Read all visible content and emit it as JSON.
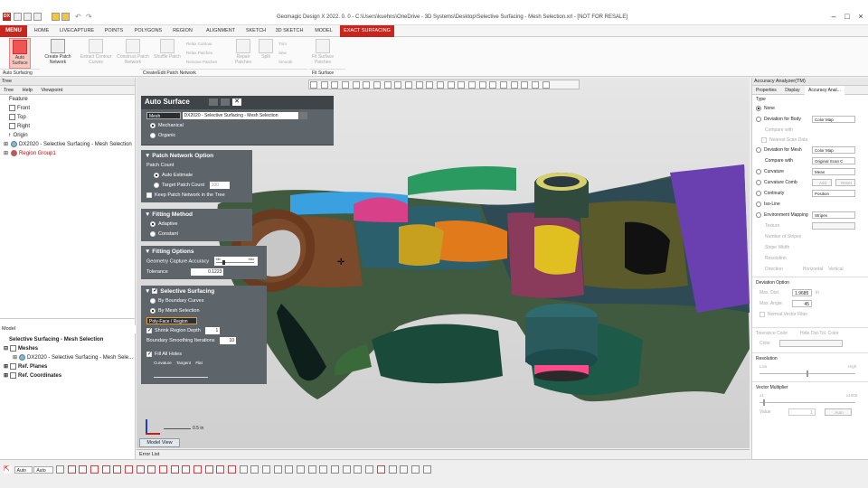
{
  "app_title": "Geomagic Design X 2022. 0. 0 - C:\\Users\\kuehns\\OneDrive - 3D Systems\\Desktop\\Selective Surfacing - Mesh Selection.xrl - [NOT FOR RESALE]",
  "app_icon_text": "DX",
  "ribbon_tabs": [
    "MENU",
    "HOME",
    "LIVECAPTURE",
    "POINTS",
    "POLYGONS",
    "REGION",
    "ALIGNMENT",
    "SKETCH",
    "3D SKETCH",
    "MODEL",
    "EXACT SURFACING"
  ],
  "ribbon": {
    "auto_surface": "Auto Surface",
    "create_patch_network": "Create Patch Network",
    "extract_contour_curves": "Extract Contour Curves",
    "construct_patch_network": "Construct Patch Network",
    "shuffle_patch": "Shuffle Patch",
    "relax_contour": "Relax Contour",
    "relax_patches": "Relax Patches",
    "remove_patches": "Remove Patches",
    "repair_patches": "Repair Patches",
    "split": "Split",
    "trim": "Trim",
    "sew": "Sew",
    "smooth": "Smooth",
    "fit_surface": "Fit Surface Patches",
    "group_auto": "Auto Surfacing",
    "group_create": "Create/Edit Patch Network",
    "group_fit": "Fit Surface"
  },
  "left_panel": {
    "title": "Tree",
    "tabs": [
      "Tree",
      "Help",
      "Viewpoint"
    ],
    "feature_label": "Feature",
    "tree_items": [
      "Front",
      "Top",
      "Right",
      "Origin",
      "DX2020 - Selective Surfacing - Mesh Selection",
      "Region Group1"
    ],
    "model_title": "Model",
    "model_root": "Selective Surfacing - Mesh Selection",
    "model_items": [
      "Meshes",
      "DX2020 - Selective Surfacing - Mesh Sele...",
      "Ref. Planes",
      "Ref. Coordinates"
    ]
  },
  "auto_surface": {
    "title": "Auto Surface",
    "mesh_button": "Mesh",
    "mesh_value": "DX2020 - Selective Surfacing - Mesh Selection",
    "mechanical": "Mechanical",
    "organic": "Organic",
    "patch_network_title": "Patch Network Option",
    "patch_count": "Patch Count",
    "auto_estimate": "Auto Estimate",
    "target_patch_count": "Target Patch Count",
    "target_patch_value": "100",
    "keep_patch": "Keep Patch Network in the Tree",
    "fitting_method_title": "Fitting Method",
    "adaptive": "Adaptive",
    "constant": "Constant",
    "fitting_options_title": "Fitting Options",
    "geometry_capture": "Geometry Capture Accuracy",
    "slider_min": "Min",
    "slider_max": "Max",
    "tolerance_label": "Tolerance",
    "tolerance_value": "0.1223",
    "selective_title": "Selective Surfacing",
    "by_boundary": "By Boundary Curves",
    "by_mesh": "By Mesh Selection",
    "polyface_button": "Poly-Face / Region",
    "shrink_region": "Shrink Region Depth",
    "shrink_value": "1",
    "boundary_smoothing": "Boundary Smoothing Iterations",
    "boundary_value": "10",
    "fill_all_holes": "Fill All Holes",
    "fill_labels": [
      "Curvature",
      "Tangent",
      "Flat"
    ]
  },
  "viewport": {
    "tab_label": "Model View",
    "scale_label": "0.5 in"
  },
  "right_panel": {
    "title": "Accuracy Analyzer(TM)",
    "tabs": [
      "Properties",
      "Display",
      "Accuracy Anal..."
    ],
    "type_label": "Type",
    "none": "None",
    "dev_body": "Deviation for Body",
    "dev_body_dd": "Color Map",
    "compare_with": "Compare with",
    "nearest_scan": "Nearest Scan Data",
    "dev_mesh": "Deviation for Mesh",
    "dev_mesh_dd": "Color Map",
    "compare_with2": "Compare with",
    "compare_with2_dd": "Original Scan C",
    "curvature": "Curvature",
    "curvature_dd": "Mean",
    "curvature_comb": "Curvature Comb",
    "comb_add": "Add",
    "comb_reset": "Reset",
    "continuity": "Continuity",
    "continuity_dd": "Position",
    "iso_line": "Iso-Line",
    "env_mapping": "Environment Mapping",
    "env_dd": "Stripes",
    "texture": "Texture",
    "num_stripes": "Number of Stripes",
    "stripe_width": "Stripe Width",
    "resolution": "Resolution",
    "direction": "Direction",
    "horizontal": "Horizontal",
    "vertical": "Vertical",
    "deviation_option": "Deviation Option",
    "max_dist": "Max. Dist.",
    "max_dist_value": "1.9685",
    "max_dist_unit": "in",
    "max_angle": "Max. Angle",
    "max_angle_value": "45",
    "normal_filter": "Normal Vector Filter",
    "tolerance_color": "Tolerance Color",
    "hide_out": "Hide Out-Tol. Color",
    "color": "Color",
    "resolution2": "Resolution",
    "res_low": "Low",
    "res_high": "High",
    "vector_multiplier": "Vector Multiplier",
    "vm_min": "x1",
    "vm_max": "x1000",
    "value": "Value",
    "value_num": "1",
    "auto": "Auto"
  },
  "status_bar": {
    "error_list": "Error List",
    "auto1": "Auto",
    "auto2": "Auto"
  }
}
